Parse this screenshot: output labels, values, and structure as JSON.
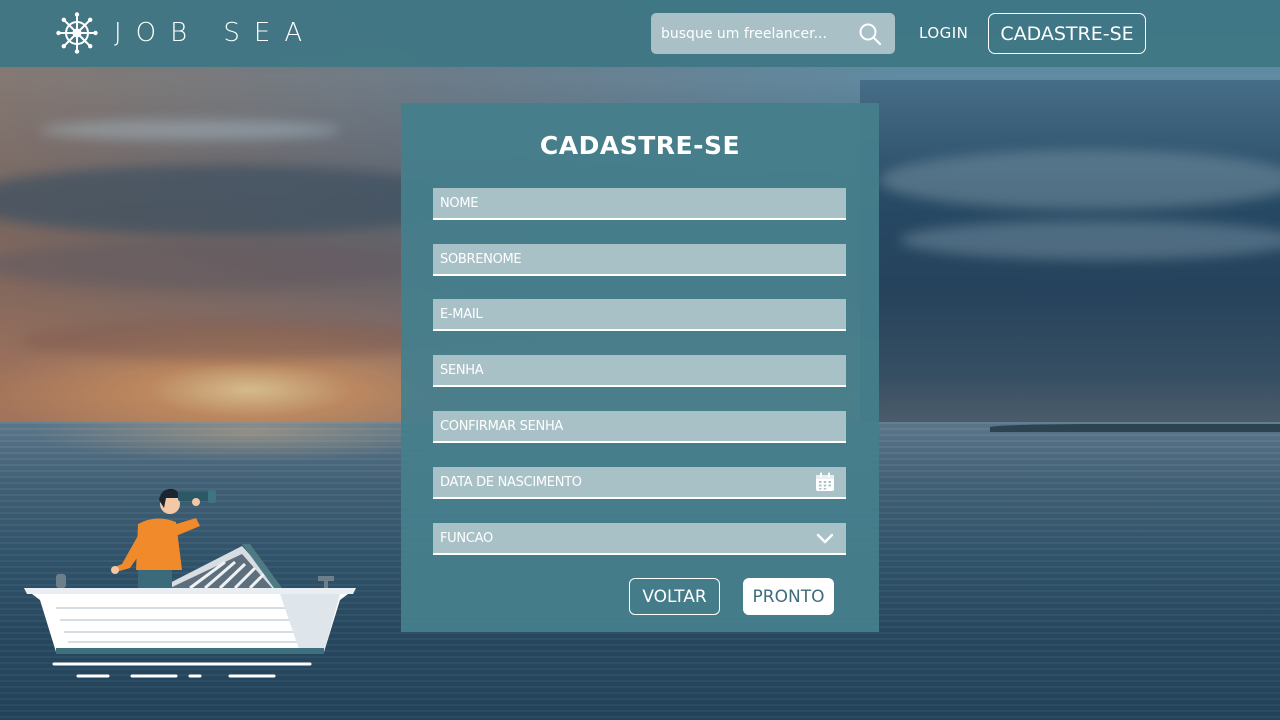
{
  "header": {
    "logo_text": "JOB SEA",
    "logo_icon": "ship-wheel-icon",
    "search": {
      "placeholder": "busque um freelancer...",
      "icon": "search-icon"
    },
    "login_label": "LOGIN",
    "signup_label": "CADASTRE-SE"
  },
  "form": {
    "title": "CADASTRE-SE",
    "fields": [
      {
        "placeholder": "NOME"
      },
      {
        "placeholder": "SOBRENOME"
      },
      {
        "placeholder": "E-MAIL"
      },
      {
        "placeholder": "SENHA"
      },
      {
        "placeholder": "CONFIRMAR SENHA"
      },
      {
        "placeholder": "DATA DE NASCIMENTO",
        "icon": "calendar-icon"
      },
      {
        "placeholder": "FUNCAO",
        "icon": "chevron-down-icon"
      }
    ],
    "back_label": "VOLTAR",
    "submit_label": "PRONTO"
  },
  "colors": {
    "header_bg": "#3e7684",
    "card_bg": "#467e8c",
    "field_bg": "#a8c1c7",
    "primary_text": "#ffffff",
    "pronto_text": "#3d6c7c"
  }
}
